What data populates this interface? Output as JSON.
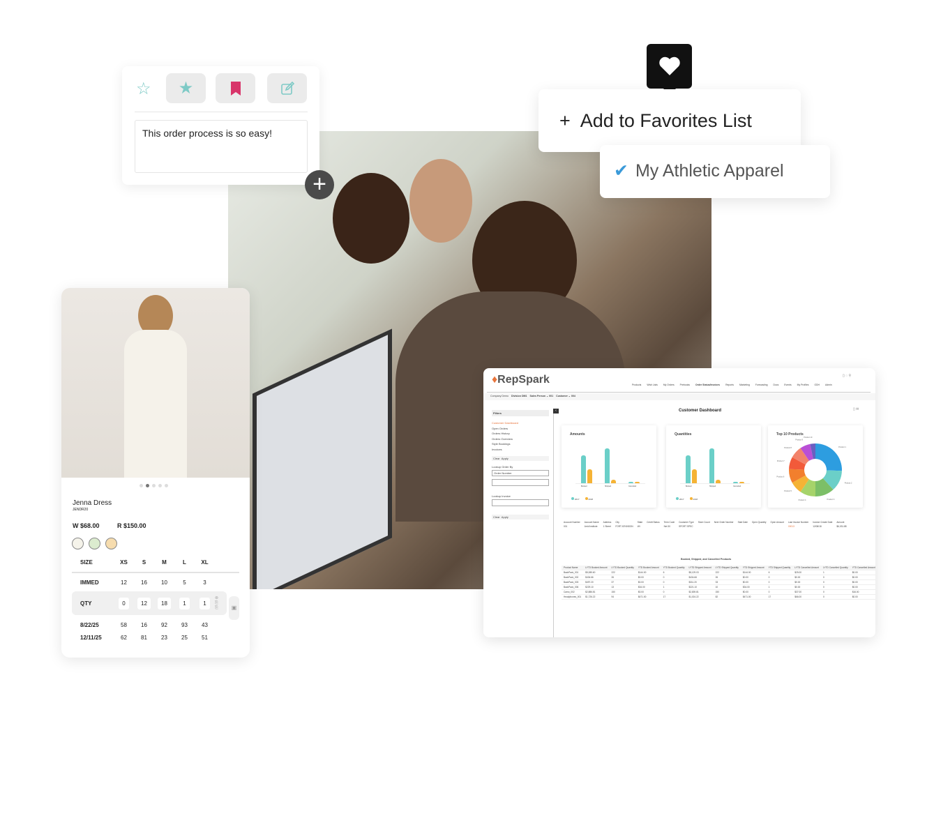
{
  "note_card": {
    "icons": [
      "star-outline-icon",
      "star-filled-icon",
      "bookmark-icon",
      "edit-icon"
    ],
    "note_text": "This order process is so easy!",
    "accent": "#7ecac6",
    "bookmark_color": "#d8356a"
  },
  "favorites": {
    "plus": "+",
    "add_label": "Add to Favorites List",
    "list_name": "My Athletic Apparel",
    "check_color": "#3a9ad9"
  },
  "product": {
    "name": "Jenna Dress",
    "sku": "JENDR20",
    "wholesale": "W $68.00",
    "retail": "R $150.00",
    "swatches": [
      "#f5f3ea",
      "#dceccf",
      "#f6dcae"
    ],
    "sizes_label": "SIZE",
    "sizes": [
      "XS",
      "S",
      "M",
      "L",
      "XL"
    ],
    "rows": [
      {
        "label": "IMMED",
        "values": [
          "12",
          "16",
          "10",
          "5",
          "3"
        ]
      },
      {
        "label": "QTY",
        "values": [
          "0",
          "12",
          "18",
          "1",
          "1"
        ]
      },
      {
        "label": "8/22/25",
        "values": [
          "58",
          "16",
          "92",
          "93",
          "43"
        ]
      },
      {
        "label": "12/11/25",
        "values": [
          "62",
          "81",
          "23",
          "25",
          "51"
        ]
      }
    ]
  },
  "dashboard": {
    "logo": "RepSpark",
    "nav": [
      "Products",
      "Wish Lists",
      "My Orders",
      "Prebooks",
      "Order Status/Invoices",
      "Reports",
      "Marketing",
      "Forecasting",
      "Docs",
      "Events",
      "My Profiles",
      "ODH",
      "Admin"
    ],
    "context": {
      "company": "Company Demo",
      "division": "Division DM1",
      "sales_person": "Sales Person ⌄ 001",
      "customer": "Customer ⌄ 004"
    },
    "title": "Customer Dashboard",
    "filters": {
      "heading": "Filters",
      "items": [
        "Customer Dashboard",
        "Open Orders",
        "Orders History",
        "Orders Overview",
        "Style Bookings",
        "Invoices"
      ],
      "clear": "Clear",
      "apply": "Apply",
      "lookup_order": "Lookup Order By",
      "order_select": "Order Number",
      "lookup_invoice": "Lookup Invoice"
    },
    "accent": "#e8743b",
    "chart_data": [
      {
        "type": "bar",
        "title": "Amounts",
        "categories": [
          "Booked",
          "Shipped",
          "Cancelled"
        ],
        "series": [
          {
            "name": "2017",
            "color": "#6bcfc8",
            "values": [
              2400,
              3000,
              150
            ]
          },
          {
            "name": "2018",
            "color": "#f5b335",
            "values": [
              1200,
              300,
              100
            ]
          }
        ]
      },
      {
        "type": "bar",
        "title": "Quantities",
        "categories": [
          "Booked",
          "Shipped",
          "Cancelled"
        ],
        "series": [
          {
            "name": "2017",
            "color": "#6bcfc8",
            "values": [
              2400,
              3000,
              150
            ]
          },
          {
            "name": "2018",
            "color": "#f5b335",
            "values": [
              1200,
              300,
              100
            ]
          }
        ]
      },
      {
        "type": "pie",
        "title": "Top 10 Products",
        "labels": [
          "Product 1",
          "Product 2",
          "Product 3",
          "Product 4",
          "Product 5",
          "Product 6",
          "Product 7",
          "Product 8",
          "Product 9",
          "Product 10"
        ],
        "values": [
          24,
          12,
          11,
          9,
          7,
          8,
          7,
          7,
          6,
          3
        ],
        "colors": [
          "#2d9de0",
          "#6bcfc8",
          "#7cbf67",
          "#a6d36a",
          "#f5b335",
          "#f27f2d",
          "#f25a3a",
          "#f2836b",
          "#b94fd6",
          "#6a5fc1"
        ]
      }
    ],
    "account_table": {
      "headers": [
        "Account Number",
        "Account Name",
        "Address",
        "City",
        "State",
        "Credit Status",
        "Term Code",
        "Customer Type",
        "Store Count",
        "Next Order Number",
        "Start Date",
        "Open Quantity",
        "Open Amount",
        "Last Invoice Number",
        "Invoice Create Date",
        "Amount"
      ],
      "row": [
        "001",
        "Arrid Institute",
        "1 Street",
        "FORT ATKINSON",
        "WI",
        "",
        "Net 30",
        "SPORT SPEC",
        "",
        "",
        "",
        "",
        "",
        "00013",
        "12/08/18",
        "$6,031.88"
      ]
    },
    "bsc_title": "Booked, Shipped, and Cancelled Products",
    "bsc_table": {
      "headers": [
        "Product Name",
        "LYTD Booked Amount",
        "LYTD Booked Quantity",
        "YTD Booked Amount",
        "YTD Booked Quantity",
        "LYTD Shipped Amount",
        "LYTD Shipped Quantity",
        "YTD Shipped Amount",
        "YTD Shipped Quantity",
        "LYTD Cancelled Amount",
        "LYTD Cancelled Quantity",
        "YTD Cancelled Amount",
        "YTD Cancelled Quantity"
      ],
      "rows": [
        [
          "BackPack_001",
          "$5,085.60",
          "222",
          "$144.00",
          "6",
          "$5,129.03",
          "222",
          "$144.00",
          "6",
          "$25.00",
          "1",
          "$0.00",
          "0"
        ],
        [
          "BackPack_002",
          "$434.66",
          "26",
          "$0.00",
          "0",
          "$434.66",
          "26",
          "$0.00",
          "0",
          "$0.00",
          "0",
          "$0.00",
          "0"
        ],
        [
          "BackPack_003",
          "$497.20",
          "37",
          "$0.00",
          "0",
          "$311.20",
          "33",
          "$0.00",
          "0",
          "$0.00",
          "0",
          "$0.00",
          "0"
        ],
        [
          "BackPack_006",
          "$229.10",
          "13",
          "$34.00",
          "1",
          "$221.10",
          "10",
          "$34.00",
          "1",
          "$0.00",
          "0",
          "$0.00",
          "0"
        ],
        [
          "Camo_002",
          "$2,886.81",
          "150",
          "$0.00",
          "0",
          "$2,839.81",
          "150",
          "$0.00",
          "0",
          "$37.00",
          "0",
          "$16.00",
          "0"
        ],
        [
          "Headphones_001",
          "$1,726.22",
          "94",
          "$471.00",
          "17",
          "$1,024.22",
          "82",
          "$471.00",
          "17",
          "$66.00",
          "0",
          "$0.00",
          "0"
        ]
      ]
    }
  }
}
